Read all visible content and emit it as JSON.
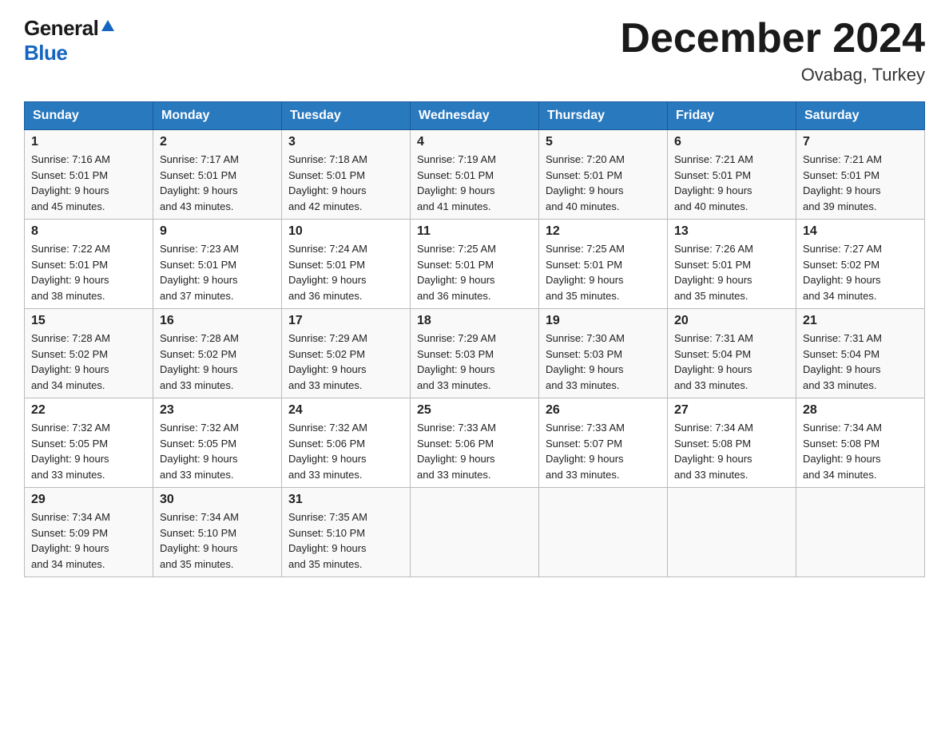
{
  "header": {
    "logo_line1": "General",
    "logo_line2": "Blue",
    "month_title": "December 2024",
    "location": "Ovabag, Turkey"
  },
  "days_of_week": [
    "Sunday",
    "Monday",
    "Tuesday",
    "Wednesday",
    "Thursday",
    "Friday",
    "Saturday"
  ],
  "weeks": [
    [
      {
        "day": "1",
        "sunrise": "7:16 AM",
        "sunset": "5:01 PM",
        "daylight": "9 hours and 45 minutes."
      },
      {
        "day": "2",
        "sunrise": "7:17 AM",
        "sunset": "5:01 PM",
        "daylight": "9 hours and 43 minutes."
      },
      {
        "day": "3",
        "sunrise": "7:18 AM",
        "sunset": "5:01 PM",
        "daylight": "9 hours and 42 minutes."
      },
      {
        "day": "4",
        "sunrise": "7:19 AM",
        "sunset": "5:01 PM",
        "daylight": "9 hours and 41 minutes."
      },
      {
        "day": "5",
        "sunrise": "7:20 AM",
        "sunset": "5:01 PM",
        "daylight": "9 hours and 40 minutes."
      },
      {
        "day": "6",
        "sunrise": "7:21 AM",
        "sunset": "5:01 PM",
        "daylight": "9 hours and 40 minutes."
      },
      {
        "day": "7",
        "sunrise": "7:21 AM",
        "sunset": "5:01 PM",
        "daylight": "9 hours and 39 minutes."
      }
    ],
    [
      {
        "day": "8",
        "sunrise": "7:22 AM",
        "sunset": "5:01 PM",
        "daylight": "9 hours and 38 minutes."
      },
      {
        "day": "9",
        "sunrise": "7:23 AM",
        "sunset": "5:01 PM",
        "daylight": "9 hours and 37 minutes."
      },
      {
        "day": "10",
        "sunrise": "7:24 AM",
        "sunset": "5:01 PM",
        "daylight": "9 hours and 36 minutes."
      },
      {
        "day": "11",
        "sunrise": "7:25 AM",
        "sunset": "5:01 PM",
        "daylight": "9 hours and 36 minutes."
      },
      {
        "day": "12",
        "sunrise": "7:25 AM",
        "sunset": "5:01 PM",
        "daylight": "9 hours and 35 minutes."
      },
      {
        "day": "13",
        "sunrise": "7:26 AM",
        "sunset": "5:01 PM",
        "daylight": "9 hours and 35 minutes."
      },
      {
        "day": "14",
        "sunrise": "7:27 AM",
        "sunset": "5:02 PM",
        "daylight": "9 hours and 34 minutes."
      }
    ],
    [
      {
        "day": "15",
        "sunrise": "7:28 AM",
        "sunset": "5:02 PM",
        "daylight": "9 hours and 34 minutes."
      },
      {
        "day": "16",
        "sunrise": "7:28 AM",
        "sunset": "5:02 PM",
        "daylight": "9 hours and 33 minutes."
      },
      {
        "day": "17",
        "sunrise": "7:29 AM",
        "sunset": "5:02 PM",
        "daylight": "9 hours and 33 minutes."
      },
      {
        "day": "18",
        "sunrise": "7:29 AM",
        "sunset": "5:03 PM",
        "daylight": "9 hours and 33 minutes."
      },
      {
        "day": "19",
        "sunrise": "7:30 AM",
        "sunset": "5:03 PM",
        "daylight": "9 hours and 33 minutes."
      },
      {
        "day": "20",
        "sunrise": "7:31 AM",
        "sunset": "5:04 PM",
        "daylight": "9 hours and 33 minutes."
      },
      {
        "day": "21",
        "sunrise": "7:31 AM",
        "sunset": "5:04 PM",
        "daylight": "9 hours and 33 minutes."
      }
    ],
    [
      {
        "day": "22",
        "sunrise": "7:32 AM",
        "sunset": "5:05 PM",
        "daylight": "9 hours and 33 minutes."
      },
      {
        "day": "23",
        "sunrise": "7:32 AM",
        "sunset": "5:05 PM",
        "daylight": "9 hours and 33 minutes."
      },
      {
        "day": "24",
        "sunrise": "7:32 AM",
        "sunset": "5:06 PM",
        "daylight": "9 hours and 33 minutes."
      },
      {
        "day": "25",
        "sunrise": "7:33 AM",
        "sunset": "5:06 PM",
        "daylight": "9 hours and 33 minutes."
      },
      {
        "day": "26",
        "sunrise": "7:33 AM",
        "sunset": "5:07 PM",
        "daylight": "9 hours and 33 minutes."
      },
      {
        "day": "27",
        "sunrise": "7:34 AM",
        "sunset": "5:08 PM",
        "daylight": "9 hours and 33 minutes."
      },
      {
        "day": "28",
        "sunrise": "7:34 AM",
        "sunset": "5:08 PM",
        "daylight": "9 hours and 34 minutes."
      }
    ],
    [
      {
        "day": "29",
        "sunrise": "7:34 AM",
        "sunset": "5:09 PM",
        "daylight": "9 hours and 34 minutes."
      },
      {
        "day": "30",
        "sunrise": "7:34 AM",
        "sunset": "5:10 PM",
        "daylight": "9 hours and 35 minutes."
      },
      {
        "day": "31",
        "sunrise": "7:35 AM",
        "sunset": "5:10 PM",
        "daylight": "9 hours and 35 minutes."
      },
      null,
      null,
      null,
      null
    ]
  ],
  "labels": {
    "sunrise_prefix": "Sunrise: ",
    "sunset_prefix": "Sunset: ",
    "daylight_prefix": "Daylight: "
  }
}
